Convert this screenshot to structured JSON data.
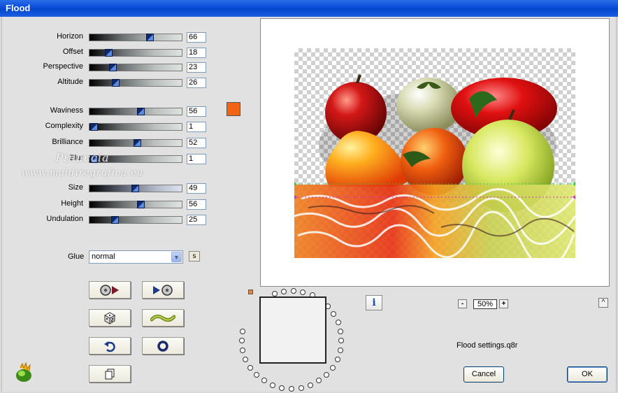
{
  "window": {
    "title": "Flood"
  },
  "params": [
    {
      "label": "Horizon",
      "value": "66",
      "fraction": 0.66,
      "style": "gray"
    },
    {
      "label": "Offset",
      "value": "18",
      "fraction": 0.18,
      "style": "gray"
    },
    {
      "label": "Perspective",
      "value": "23",
      "fraction": 0.23,
      "style": "gray"
    },
    {
      "label": "Altitude",
      "value": "26",
      "fraction": 0.26,
      "style": "gray"
    },
    {
      "label": "Waviness",
      "value": "56",
      "fraction": 0.56,
      "style": "gray"
    },
    {
      "label": "Complexity",
      "value": "1",
      "fraction": 0.01,
      "style": "gray"
    },
    {
      "label": "Brilliance",
      "value": "52",
      "fraction": 0.52,
      "style": "gray"
    },
    {
      "label": "Blur",
      "value": "1",
      "fraction": 0.01,
      "style": "gray"
    },
    {
      "label": "Size",
      "value": "49",
      "fraction": 0.49,
      "style": "blue"
    },
    {
      "label": "Height",
      "value": "56",
      "fraction": 0.56,
      "style": "gray"
    },
    {
      "label": "Undulation",
      "value": "25",
      "fraction": 0.25,
      "style": "gray"
    }
  ],
  "color": {
    "swatch": "#f06414",
    "icon": "color-swatch-icon"
  },
  "glue": {
    "label": "Glue",
    "value": "normal",
    "s_label": "s"
  },
  "toolbar": [
    {
      "icon": "filmstrip-play-icon"
    },
    {
      "icon": "play-filmstrip-icon"
    },
    {
      "icon": "dice-random-icon"
    },
    {
      "icon": "wave-icon"
    },
    {
      "icon": "undo-arrow-icon"
    },
    {
      "icon": "reset-circle-icon"
    },
    {
      "icon": "copy-pages-icon"
    }
  ],
  "watermark": {
    "line1": "Pinuccia",
    "line2": "www.maldiregrafica.eu"
  },
  "preview": {
    "zoom": "50%",
    "zoom_minus": "-",
    "zoom_plus": "+",
    "caret": "^",
    "info": "i"
  },
  "settings_file": "Flood settings.q8r",
  "buttons": {
    "cancel": "Cancel",
    "ok": "OK"
  }
}
